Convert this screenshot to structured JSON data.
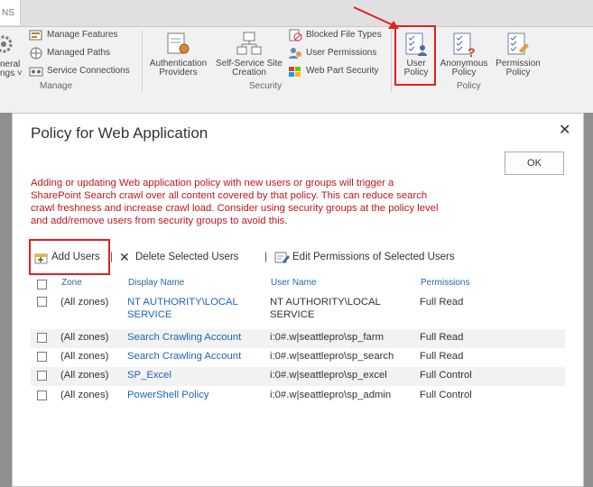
{
  "ribbon": {
    "tab_label": "NS",
    "left_partial": {
      "line1": "neral",
      "line2": "ngs ˅"
    },
    "manage_group": {
      "label": "Manage",
      "items": [
        "Manage Features",
        "Managed Paths",
        "Service Connections"
      ]
    },
    "security_group": {
      "label": "Security",
      "big_buttons": [
        {
          "line1": "Authentication",
          "line2": "Providers"
        },
        {
          "line1": "Self-Service Site",
          "line2": "Creation"
        }
      ],
      "items": [
        "Blocked File Types",
        "User Permissions",
        "Web Part Security"
      ]
    },
    "policy_group": {
      "label": "Policy",
      "buttons": [
        {
          "line1": "User",
          "line2": "Policy"
        },
        {
          "line1": "Anonymous",
          "line2": "Policy"
        },
        {
          "line1": "Permission",
          "line2": "Policy"
        }
      ]
    }
  },
  "dialog": {
    "title": "Policy for Web Application",
    "close": "✕",
    "ok_label": "OK",
    "warning_lines": [
      "Adding or updating Web application policy with new users or groups will trigger a",
      "SharePoint Search crawl over all content covered by that policy. This can reduce search",
      "crawl freshness and increase crawl load. Consider using security groups at the policy level",
      "and add/remove users from security groups to avoid this."
    ],
    "toolbar": {
      "add_users": "Add Users",
      "delete_selected": "Delete Selected Users",
      "edit_permissions": "Edit Permissions of Selected Users",
      "separator": "|"
    },
    "table": {
      "headers": [
        "Zone",
        "Display Name",
        "User Name",
        "Permissions"
      ],
      "rows": [
        {
          "zone": "(All zones)",
          "display_name_1": "NT AUTHORITY\\LOCAL",
          "display_name_2": "SERVICE",
          "user_name_1": "NT AUTHORITY\\LOCAL",
          "user_name_2": "SERVICE",
          "permissions": "Full Read"
        },
        {
          "zone": "(All zones)",
          "display_name_1": "Search Crawling Account",
          "user_name_1": "i:0#.w|seattlepro\\sp_farm",
          "permissions": "Full Read"
        },
        {
          "zone": "(All zones)",
          "display_name_1": "Search Crawling Account",
          "user_name_1": "i:0#.w|seattlepro\\sp_search",
          "permissions": "Full Read"
        },
        {
          "zone": "(All zones)",
          "display_name_1": "SP_Excel",
          "user_name_1": "i:0#.w|seattlepro\\sp_excel",
          "permissions": "Full Control"
        },
        {
          "zone": "(All zones)",
          "display_name_1": "PowerShell Policy",
          "user_name_1": "i:0#.w|seattlepro\\sp_admin",
          "permissions": "Full Control"
        }
      ]
    }
  },
  "colors": {
    "warning": "#c0161c",
    "link": "#1e64b6",
    "highlight": "#e32020"
  }
}
